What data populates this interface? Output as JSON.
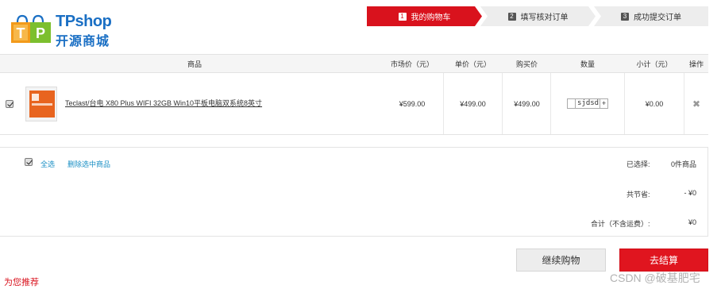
{
  "logo": {
    "brand_en": "TPshop",
    "brand_cn": "开源商城"
  },
  "steps": [
    {
      "num": "1",
      "label": "我的购物车",
      "active": true
    },
    {
      "num": "2",
      "label": "填写核对订单",
      "active": false
    },
    {
      "num": "3",
      "label": "成功提交订单",
      "active": false
    }
  ],
  "table": {
    "headers": {
      "product": "商品",
      "market_price": "市场价（元）",
      "unit_price": "单价（元）",
      "purchase_price": "购买价",
      "quantity": "数量",
      "subtotal": "小计（元）",
      "action": "操作"
    },
    "rows": [
      {
        "checked": true,
        "name": "Teclast/台电 X80 Plus WIFI 32GB Win10平板电脑双系统8英寸",
        "market_price": "¥599.00",
        "unit_price": "¥499.00",
        "purchase_price": "¥499.00",
        "quantity": "sjdsd",
        "quantity_minus": "",
        "quantity_plus": "+",
        "subtotal": "¥0.00",
        "delete_glyph": "✖"
      }
    ]
  },
  "summary": {
    "select_all": "全选",
    "delete_selected": "删除选中商品",
    "selected_label": "已选择:",
    "selected_value": "0件商品",
    "saved_label": "共节省:",
    "saved_value": "- ¥0",
    "total_label": "合计（不含运费）:",
    "total_value": "¥0"
  },
  "buttons": {
    "continue": "继续购物",
    "checkout": "去结算"
  },
  "recommend": "为您推荐",
  "watermark": "CSDN @破基肥宅",
  "colors": {
    "accent": "#d9121d",
    "link": "#1a8fc4",
    "brand": "#1a6fc4"
  }
}
